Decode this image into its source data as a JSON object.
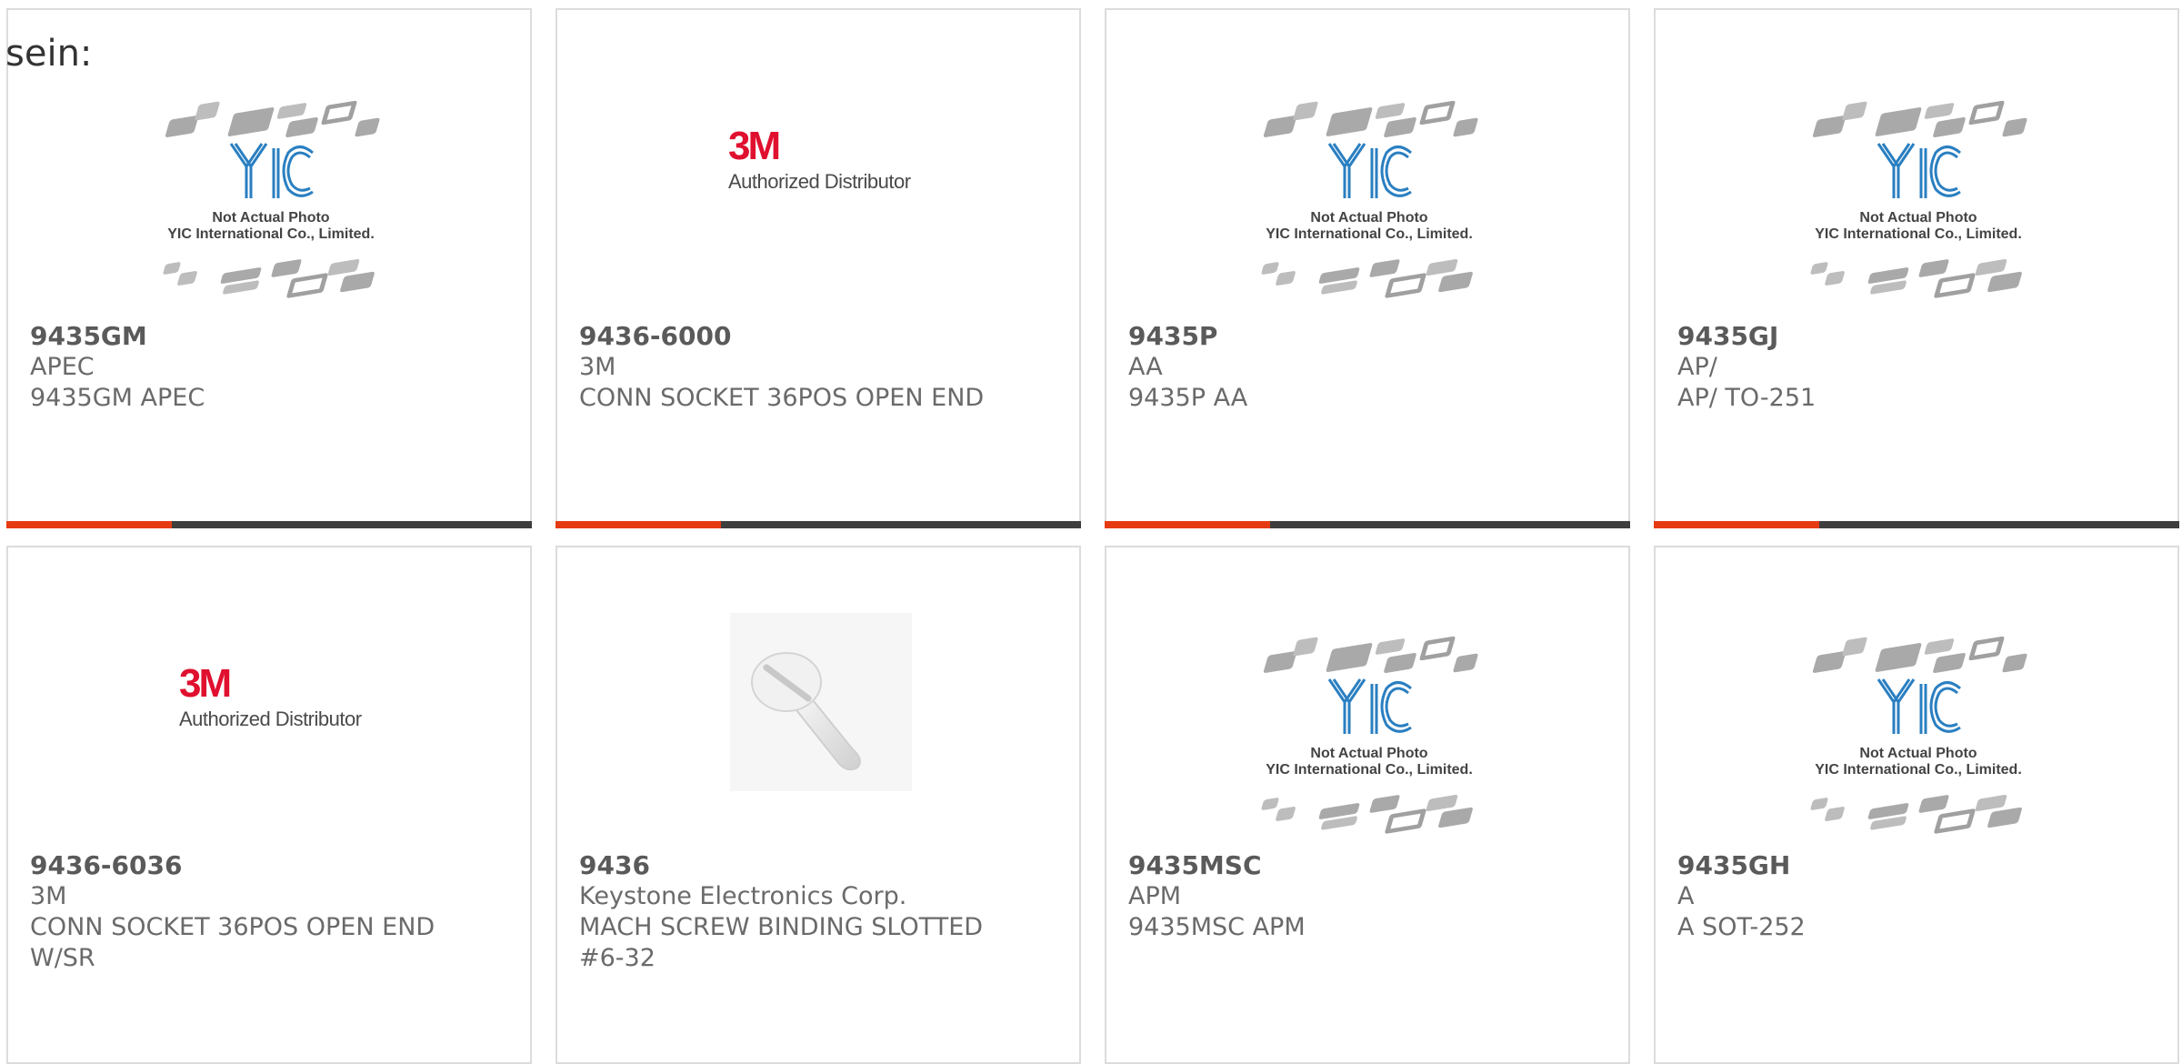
{
  "overlay_text": "sein:",
  "placeholder": {
    "line1": "Not Actual Photo",
    "line2": "YIC International Co., Limited."
  },
  "brand_logo": {
    "mark": "3M",
    "sub": "Authorized Distributor"
  },
  "colors": {
    "accent": "#e63a12",
    "bar": "#3e3e3e",
    "border": "#dcdcdc",
    "brand_red": "#e0102f",
    "yic_blue": "#2a7fc1"
  },
  "products": [
    {
      "part": "9435GM",
      "manufacturer": "APEC",
      "description": "9435GM APEC",
      "image": "yic-placeholder"
    },
    {
      "part": "9436-6000",
      "manufacturer": "3M",
      "description": "CONN SOCKET 36POS OPEN END",
      "image": "3m-logo"
    },
    {
      "part": "9435P",
      "manufacturer": "AA",
      "description": "9435P AA",
      "image": "yic-placeholder"
    },
    {
      "part": "9435GJ",
      "manufacturer": "AP/",
      "description": "AP/ TO-251",
      "image": "yic-placeholder"
    },
    {
      "part": "9436-6036",
      "manufacturer": "3M",
      "description": "CONN SOCKET 36POS OPEN END\nW/SR",
      "image": "3m-logo"
    },
    {
      "part": "9436",
      "manufacturer": "Keystone Electronics Corp.",
      "description": "MACH SCREW BINDING SLOTTED\n#6-32",
      "image": "screw-photo"
    },
    {
      "part": "9435MSC",
      "manufacturer": "APM",
      "description": "9435MSC APM",
      "image": "yic-placeholder"
    },
    {
      "part": "9435GH",
      "manufacturer": "A",
      "description": "A SOT-252",
      "image": "yic-placeholder"
    }
  ]
}
